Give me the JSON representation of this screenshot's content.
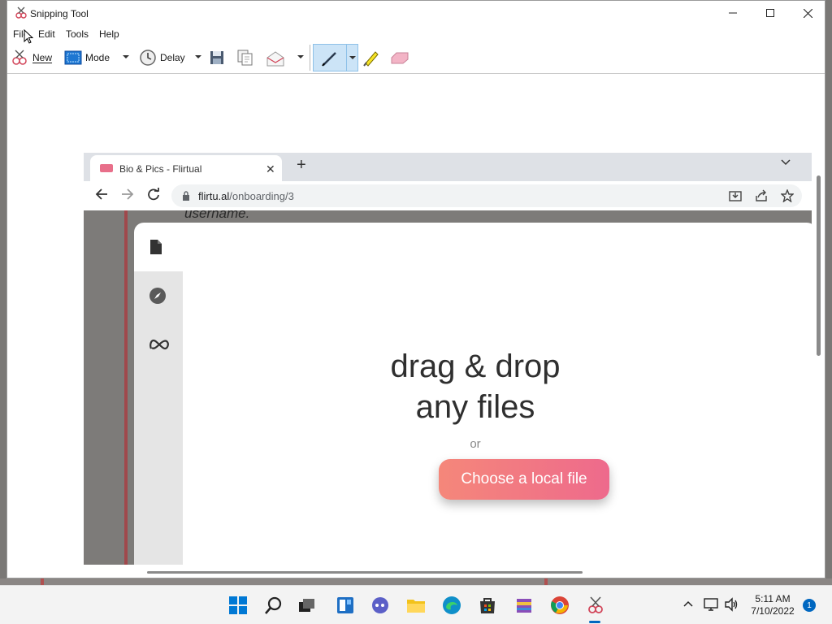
{
  "window": {
    "title": "Snipping Tool"
  },
  "menu": [
    "File",
    "Edit",
    "Tools",
    "Help"
  ],
  "toolbar": {
    "new_label": "New",
    "mode_label": "Mode",
    "delay_label": "Delay"
  },
  "browser": {
    "tab_title": "Bio & Pics - Flirtual",
    "url_host": "flirtu.al",
    "url_path": "/onboarding/3",
    "page_hint": "username.",
    "drop_line1": "drag & drop",
    "drop_line2": "any files",
    "or_text": "or",
    "choose_label": "Choose a local file"
  },
  "taskbar": {
    "time": "5:11 AM",
    "date": "7/10/2022",
    "notification_count": "1"
  },
  "colors": {
    "accent": "#0067c0",
    "button_gradient_start": "#f5877a",
    "button_gradient_end": "#ee6a8c"
  },
  "icons": [
    "snipping-tool-icon",
    "minimize-icon",
    "maximize-icon",
    "close-icon",
    "new-snip-icon",
    "mode-icon",
    "delay-clock-icon",
    "save-icon",
    "copy-icon",
    "send-icon",
    "pen-icon",
    "highlighter-icon",
    "eraser-icon",
    "back-icon",
    "forward-icon",
    "reload-icon",
    "lock-icon",
    "install-icon",
    "share-icon",
    "bookmark-star-icon",
    "file-icon",
    "compass-icon",
    "meta-icon",
    "windows-start-icon",
    "search-icon",
    "task-view-icon",
    "widgets-icon",
    "chat-icon",
    "file-explorer-icon",
    "edge-icon",
    "store-icon",
    "winrar-icon",
    "chrome-icon",
    "chevron-up-icon",
    "network-icon",
    "volume-icon"
  ]
}
